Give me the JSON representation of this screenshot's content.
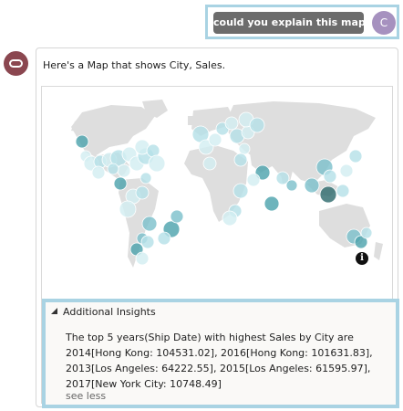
{
  "user": {
    "message": "could you explain this map?",
    "avatar_letter": "C"
  },
  "bot": {
    "intro": "Here's a Map that shows City, Sales."
  },
  "map": {
    "info_icon": "i",
    "land_color": "#dedede",
    "bubble_colors": [
      "#d3eef2",
      "#b6e1e8",
      "#7ec1cc",
      "#4ea3ad",
      "#2f6b6e"
    ]
  },
  "insights": {
    "title": "Additional Insights",
    "lines": [
      "The top 5 years(Ship Date) with highest Sales by City are",
      "2014[Hong Kong: 104531.02], 2016[Hong Kong: 101631.83],",
      "2013[Los Angeles: 64222.55], 2015[Los Angeles: 61595.97],",
      "2017[New York City: 10748.49]"
    ],
    "see_less": "see less"
  }
}
